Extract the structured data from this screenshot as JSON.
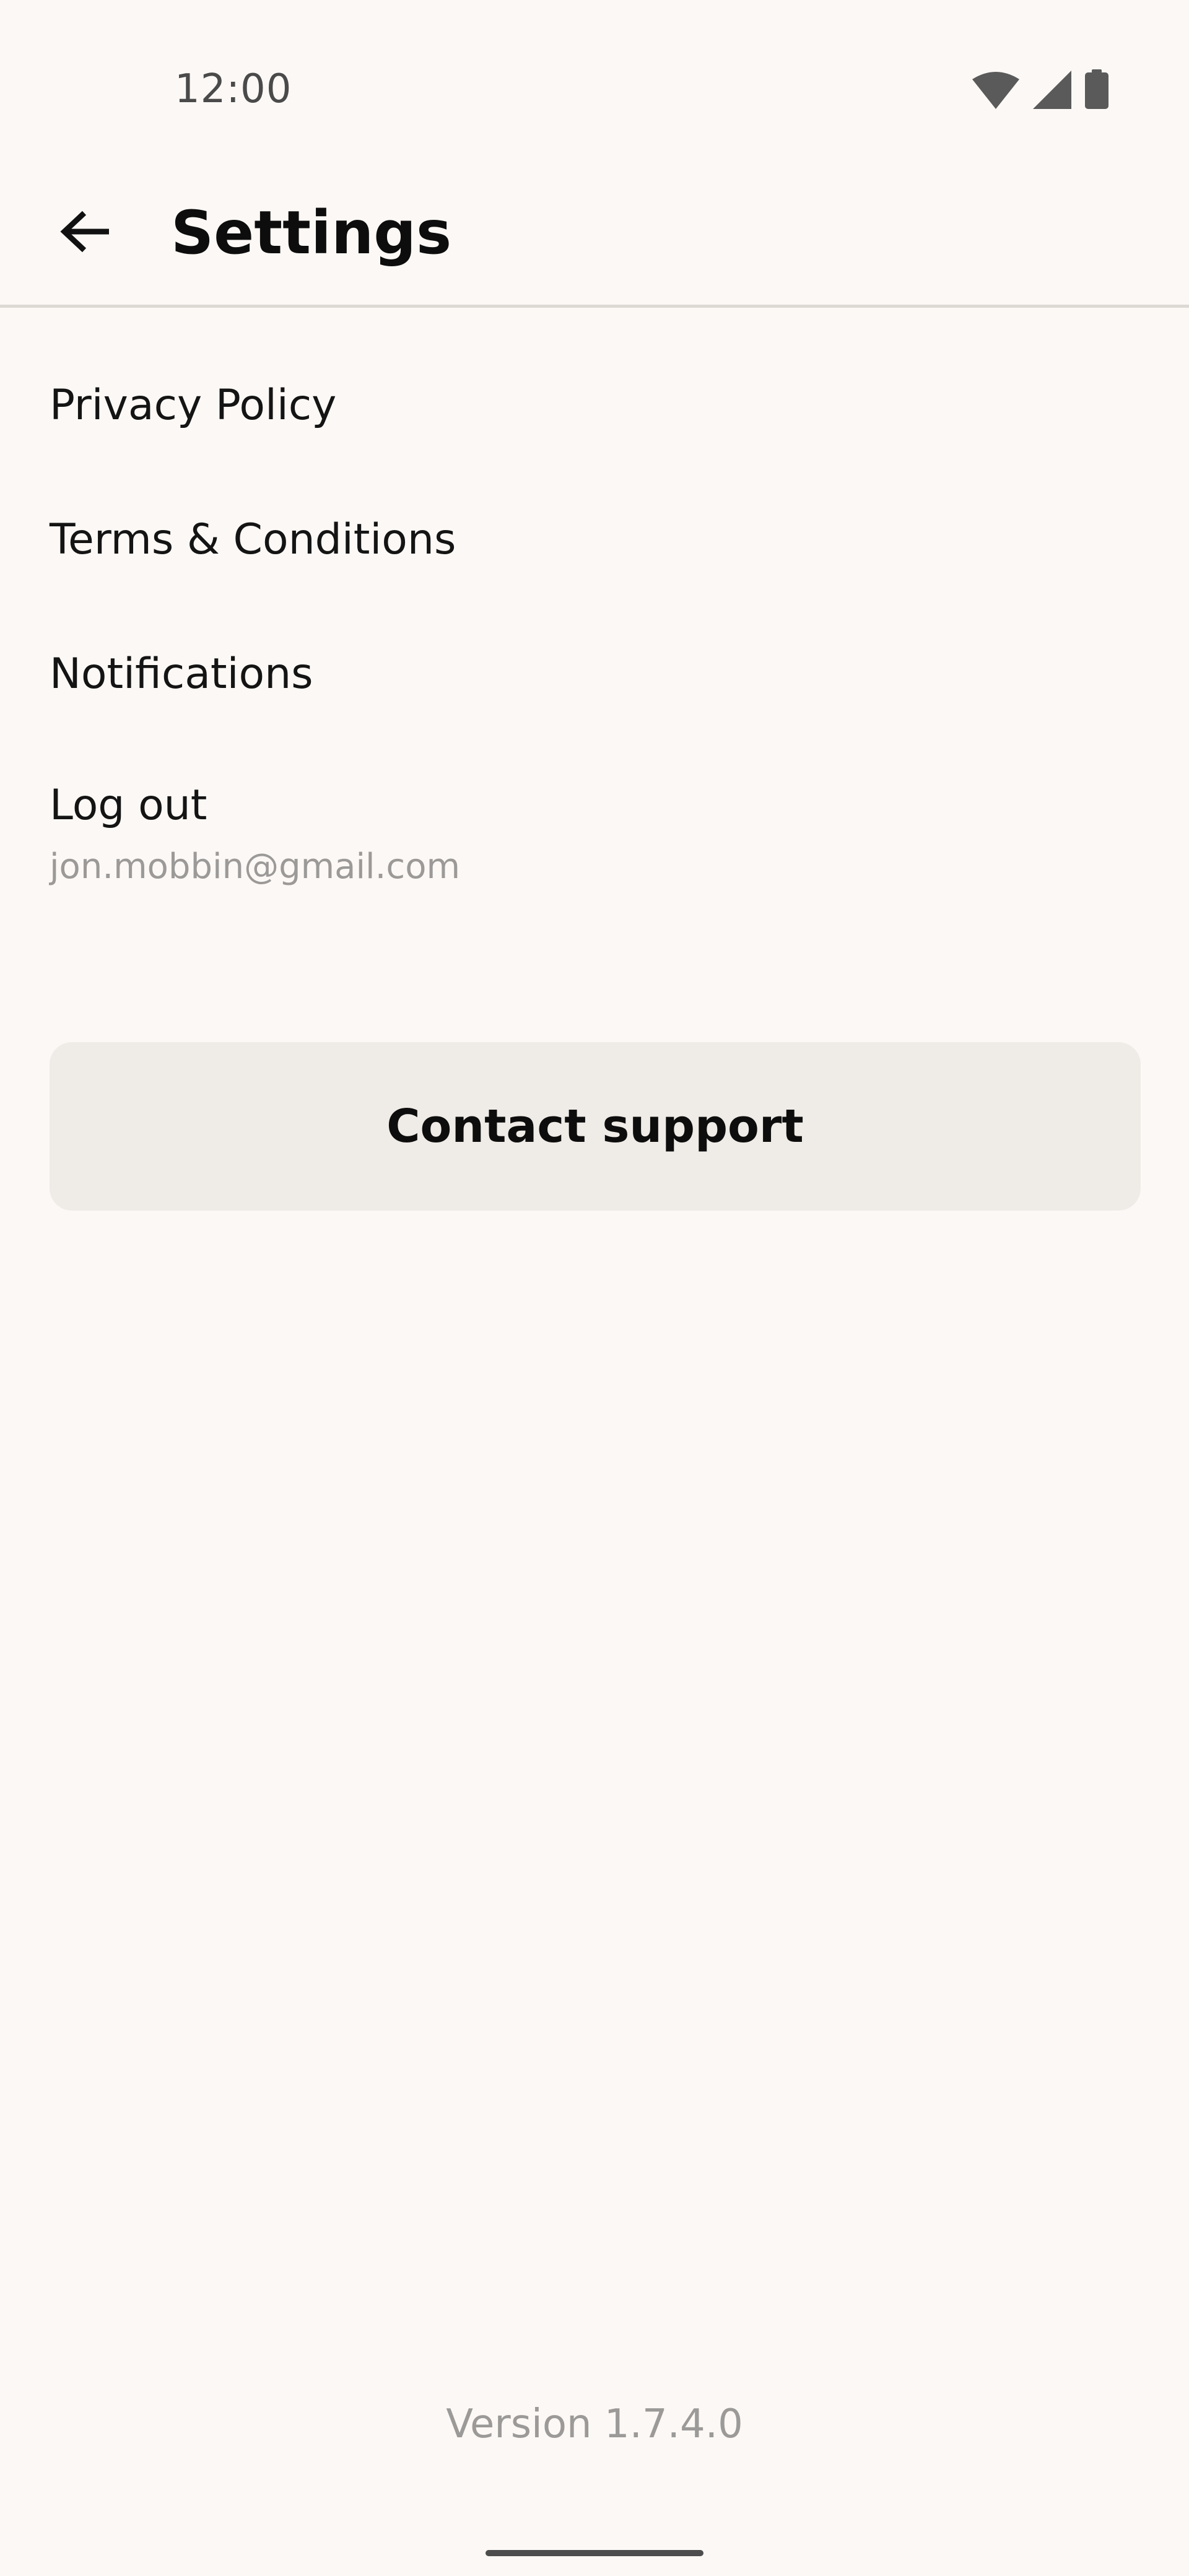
{
  "status_bar": {
    "time": "12:00",
    "icons": [
      "wifi-icon",
      "cell-signal-icon",
      "battery-icon"
    ]
  },
  "app_bar": {
    "back_icon": "arrow-left-icon",
    "title": "Settings"
  },
  "settings": {
    "items": [
      {
        "label": "Privacy Policy"
      },
      {
        "label": "Terms & Conditions"
      },
      {
        "label": "Notifications"
      }
    ],
    "logout": {
      "label": "Log out",
      "email": "jon.mobbin@gmail.com"
    }
  },
  "contact": {
    "label": "Contact support"
  },
  "footer": {
    "version": "Version 1.7.4.0"
  },
  "colors": {
    "background": "#fcf8f5",
    "button_background": "#efebe7",
    "divider": "#dcd8d4",
    "muted_text": "#9c9a98",
    "primary_text": "#0d0d0d"
  }
}
